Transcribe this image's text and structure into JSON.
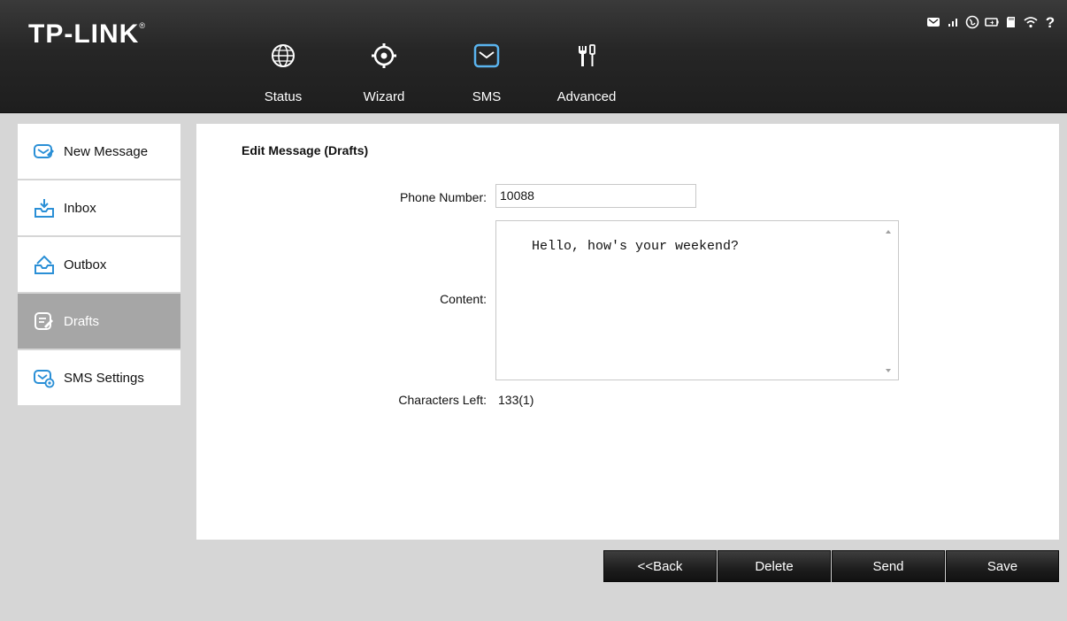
{
  "brand": {
    "logo": "TP-LINK",
    "registered": "®"
  },
  "nav": [
    {
      "label": "Status",
      "icon": "globe-icon"
    },
    {
      "label": "Wizard",
      "icon": "gear-icon"
    },
    {
      "label": "SMS",
      "icon": "envelope-icon",
      "active": true
    },
    {
      "label": "Advanced",
      "icon": "tools-icon"
    }
  ],
  "status_icons": [
    "message-icon",
    "signal-icon",
    "internet-icon",
    "battery-icon",
    "sd-card-icon",
    "wifi-icon",
    "help-icon"
  ],
  "sidebar": {
    "items": [
      {
        "label": "New Message",
        "icon": "new-message-icon"
      },
      {
        "label": "Inbox",
        "icon": "inbox-icon"
      },
      {
        "label": "Outbox",
        "icon": "outbox-icon"
      },
      {
        "label": "Drafts",
        "icon": "drafts-icon",
        "active": true
      },
      {
        "label": "SMS Settings",
        "icon": "sms-settings-icon"
      }
    ]
  },
  "form": {
    "title": "Edit Message (Drafts)",
    "phone_label": "Phone Number:",
    "phone_value": "10088",
    "content_label": "Content:",
    "content_value": "Hello, how's your weekend?",
    "chars_label": "Characters Left:",
    "chars_value": "133(1)"
  },
  "buttons": {
    "back": "<<Back",
    "delete": "Delete",
    "send": "Send",
    "save": "Save"
  },
  "colors": {
    "accent": "#2a8fd6",
    "header": "#262626",
    "active_side": "#a6a6a6"
  }
}
